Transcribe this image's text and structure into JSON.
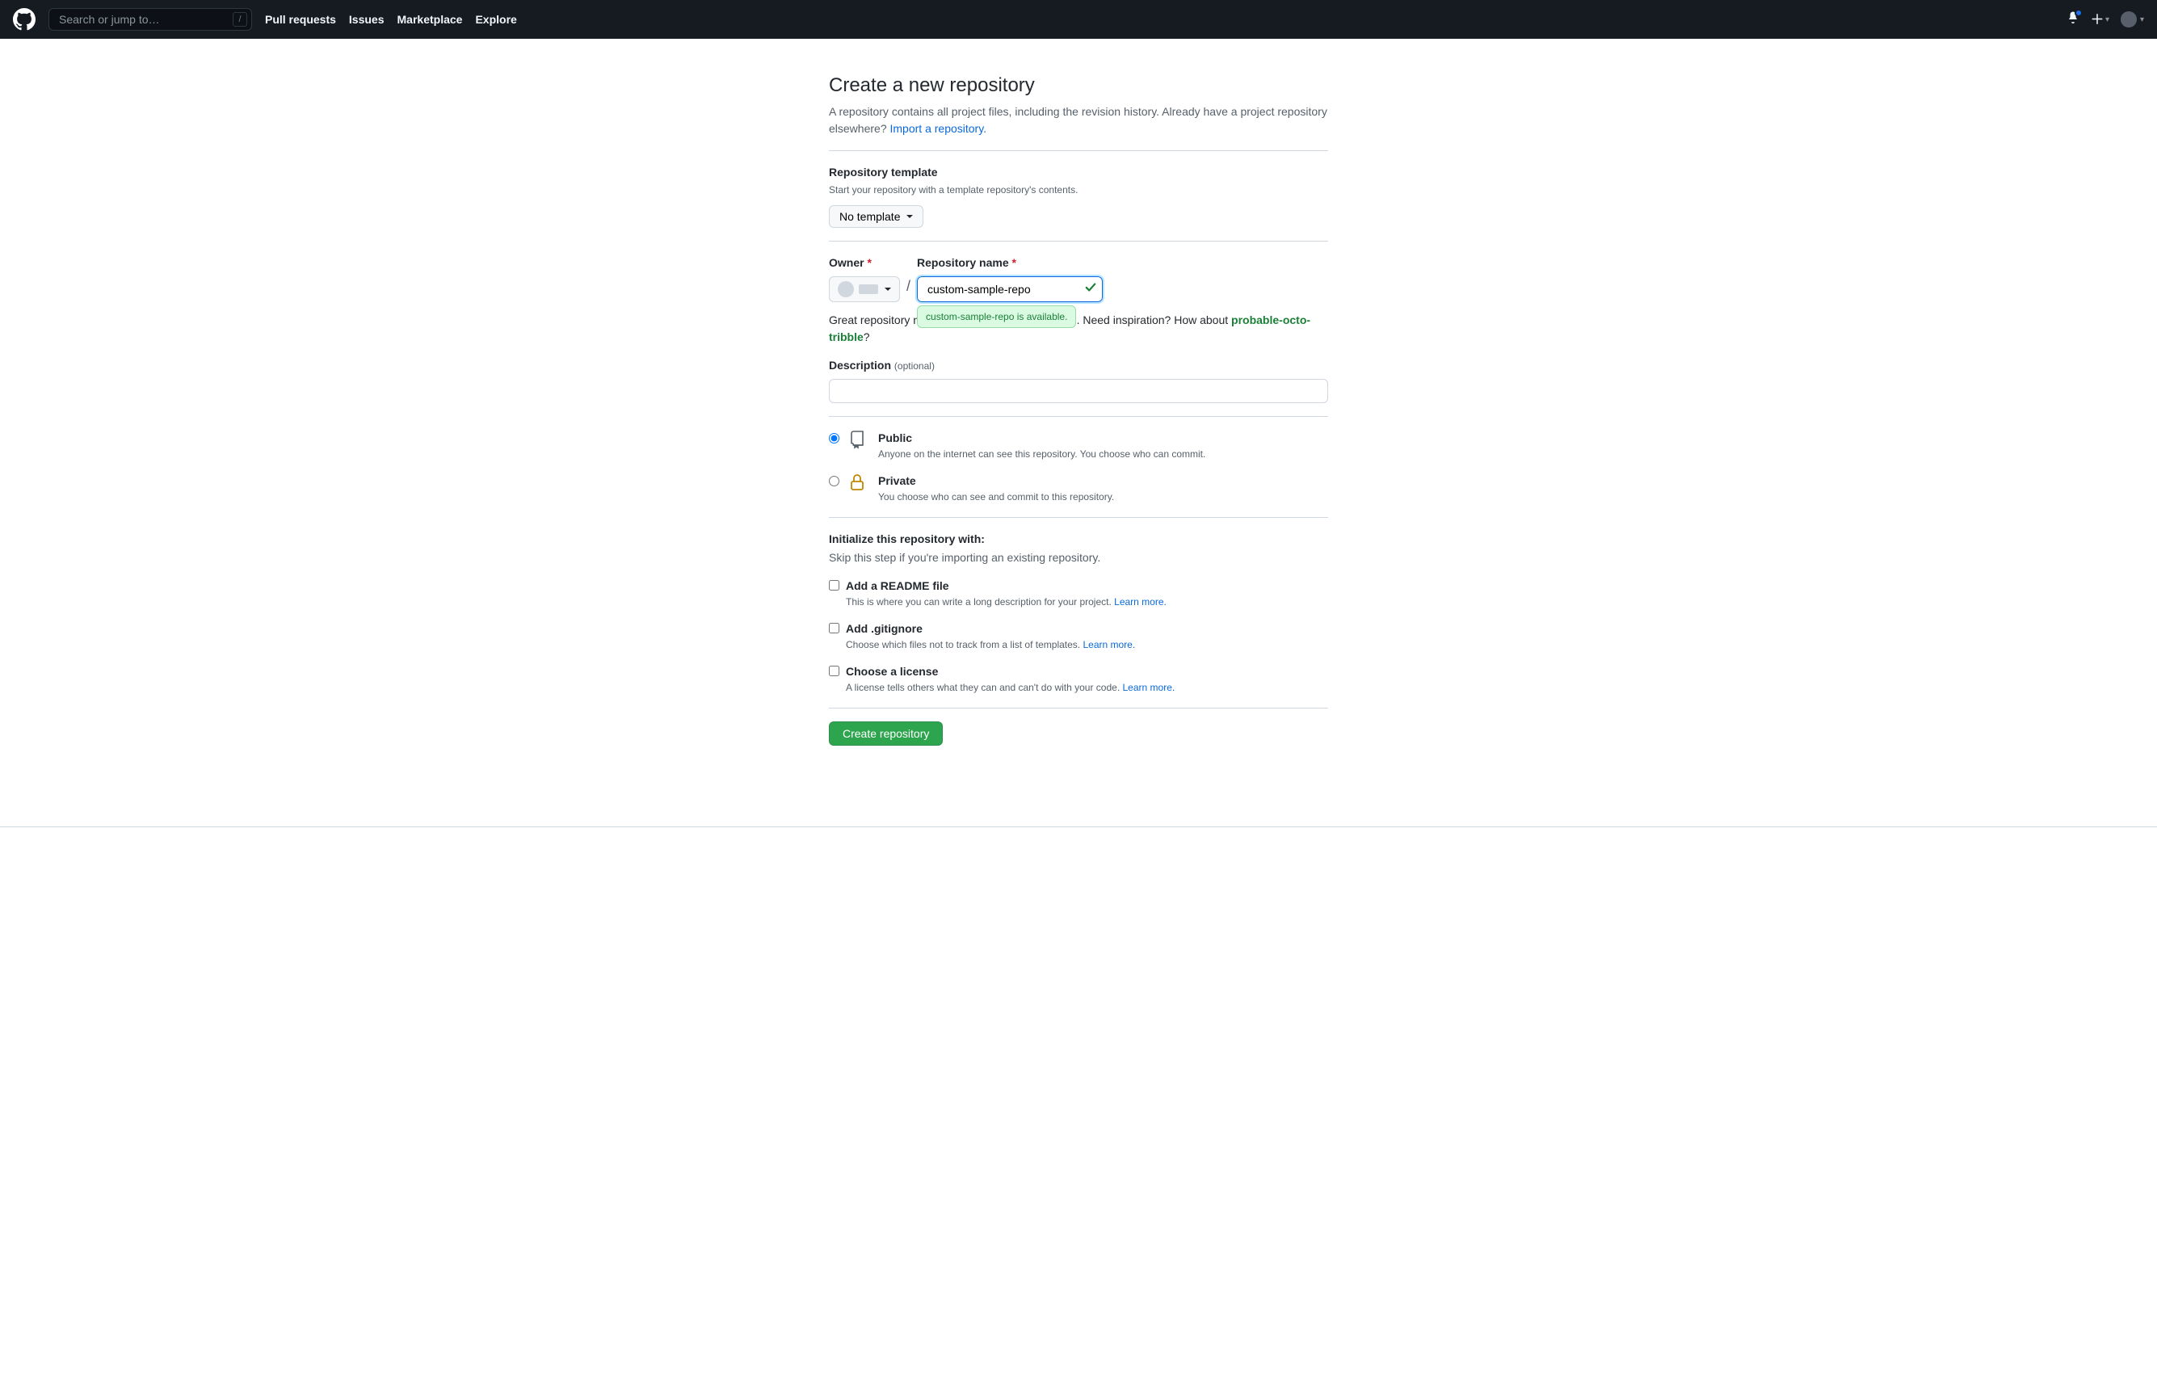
{
  "header": {
    "search_placeholder": "Search or jump to…",
    "slash": "/",
    "links": [
      "Pull requests",
      "Issues",
      "Marketplace",
      "Explore"
    ]
  },
  "page": {
    "title": "Create a new repository",
    "subhead_prefix": "A repository contains all project files, including the revision history. Already have a project repository elsewhere? ",
    "import_link": "Import a repository."
  },
  "template": {
    "heading": "Repository template",
    "sub": "Start your repository with a template repository's contents.",
    "button": "No template"
  },
  "owner": {
    "label": "Owner",
    "required": "*"
  },
  "repo_name": {
    "label": "Repository name",
    "required": "*",
    "value": "custom-sample-repo",
    "available_tip": "custom-sample-repo is available."
  },
  "suggestion": {
    "prefix": "Great repository names are short and memorable. Need inspiration? How about ",
    "name": "probable-octo-tribble",
    "suffix": "?"
  },
  "description": {
    "label": "Description",
    "optional": "(optional)",
    "value": ""
  },
  "visibility": {
    "public": {
      "title": "Public",
      "desc": "Anyone on the internet can see this repository. You choose who can commit."
    },
    "private": {
      "title": "Private",
      "desc": "You choose who can see and commit to this repository."
    }
  },
  "init": {
    "heading": "Initialize this repository with:",
    "sub": "Skip this step if you're importing an existing repository.",
    "readme": {
      "title": "Add a README file",
      "desc": "This is where you can write a long description for your project. ",
      "link": "Learn more."
    },
    "gitignore": {
      "title": "Add .gitignore",
      "desc": "Choose which files not to track from a list of templates. ",
      "link": "Learn more."
    },
    "license": {
      "title": "Choose a license",
      "desc": "A license tells others what they can and can't do with your code. ",
      "link": "Learn more."
    }
  },
  "submit": "Create repository"
}
